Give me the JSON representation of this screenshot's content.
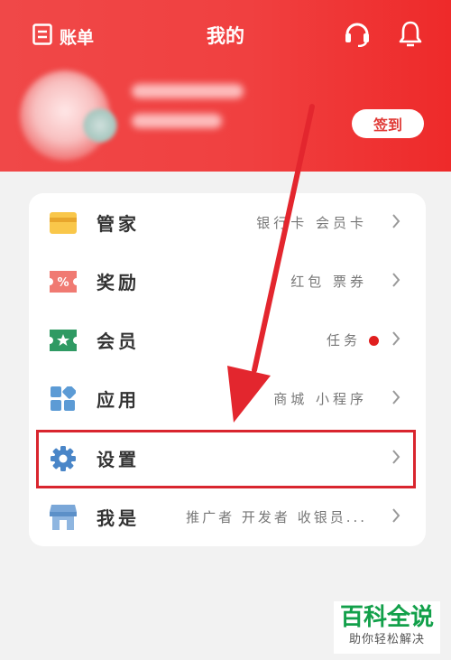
{
  "header": {
    "bill_label": "账单",
    "title": "我的",
    "checkin_label": "签到",
    "bg_color": "#f04848"
  },
  "menu": [
    {
      "name": "管家",
      "sub": "银行卡 会员卡",
      "icon": "card-icon"
    },
    {
      "name": "奖励",
      "sub": "红包 票券",
      "icon": "coupon-icon"
    },
    {
      "name": "会员",
      "sub": "任务",
      "icon": "member-icon",
      "badge": true
    },
    {
      "name": "应用",
      "sub": "商城 小程序",
      "icon": "apps-icon"
    },
    {
      "name": "设置",
      "sub": "",
      "icon": "gear-icon"
    },
    {
      "name": "我是",
      "sub": "推广者 开发者 收银员...",
      "icon": "store-icon"
    }
  ],
  "watermark": {
    "title": "百科全说",
    "subtitle": "助你轻松解决"
  },
  "colors": {
    "annotation_red": "#d9252e",
    "badge_red": "#e01e1e",
    "checkin_text": "#e03a36"
  }
}
